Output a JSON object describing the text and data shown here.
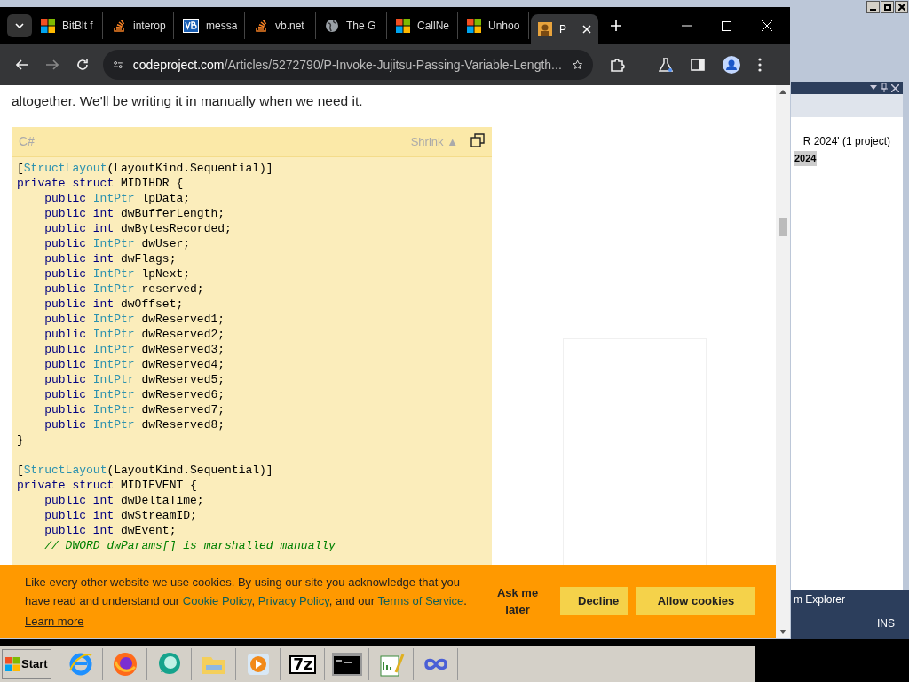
{
  "browser": {
    "tabs": [
      {
        "title": "BitBlt f",
        "kind": "windows",
        "selected": false
      },
      {
        "title": "interop",
        "kind": "stack",
        "selected": false
      },
      {
        "title": "messa",
        "kind": "vb",
        "selected": false
      },
      {
        "title": "vb.net",
        "kind": "stack",
        "selected": false
      },
      {
        "title": "The G",
        "kind": "globe",
        "selected": false
      },
      {
        "title": "CallNe",
        "kind": "windows",
        "selected": false
      },
      {
        "title": "Unhoo",
        "kind": "windows",
        "selected": false
      },
      {
        "title": "P",
        "kind": "site",
        "selected": true
      }
    ],
    "address": {
      "host": "codeproject.com",
      "path": "/Articles/5272790/P-Invoke-Jujitsu-Passing-Variable-Length..."
    }
  },
  "article": {
    "paragraph": "altogether. We'll be writing it in manually when we need it.",
    "code_block": {
      "language": "C#",
      "toggle": "Shrink ▲",
      "sections": [
        [
          [
            {
              "kind": "plain",
              "text": "["
            },
            {
              "kind": "type",
              "text": "StructLayout"
            },
            {
              "kind": "plain",
              "text": "(LayoutKind.Sequential)]"
            }
          ],
          [
            {
              "kind": "keyword",
              "text": "private struct"
            },
            {
              "kind": "plain",
              "text": " MIDIHDR {"
            }
          ],
          [
            {
              "kind": "keyword",
              "text": "    public"
            },
            {
              "kind": "type",
              "text": " IntPtr"
            },
            {
              "kind": "plain",
              "text": " lpData;"
            }
          ],
          [
            {
              "kind": "keyword",
              "text": "    public int"
            },
            {
              "kind": "plain",
              "text": " dwBufferLength;"
            }
          ],
          [
            {
              "kind": "keyword",
              "text": "    public int"
            },
            {
              "kind": "plain",
              "text": " dwBytesRecorded;"
            }
          ],
          [
            {
              "kind": "keyword",
              "text": "    public"
            },
            {
              "kind": "type",
              "text": " IntPtr"
            },
            {
              "kind": "plain",
              "text": " dwUser;"
            }
          ],
          [
            {
              "kind": "keyword",
              "text": "    public int"
            },
            {
              "kind": "plain",
              "text": " dwFlags;"
            }
          ],
          [
            {
              "kind": "keyword",
              "text": "    public"
            },
            {
              "kind": "type",
              "text": " IntPtr"
            },
            {
              "kind": "plain",
              "text": " lpNext;"
            }
          ],
          [
            {
              "kind": "keyword",
              "text": "    public"
            },
            {
              "kind": "type",
              "text": " IntPtr"
            },
            {
              "kind": "plain",
              "text": " reserved;"
            }
          ],
          [
            {
              "kind": "keyword",
              "text": "    public int"
            },
            {
              "kind": "plain",
              "text": " dwOffset;"
            }
          ],
          [
            {
              "kind": "keyword",
              "text": "    public"
            },
            {
              "kind": "type",
              "text": " IntPtr"
            },
            {
              "kind": "plain",
              "text": " dwReserved1;"
            }
          ],
          [
            {
              "kind": "keyword",
              "text": "    public"
            },
            {
              "kind": "type",
              "text": " IntPtr"
            },
            {
              "kind": "plain",
              "text": " dwReserved2;"
            }
          ],
          [
            {
              "kind": "keyword",
              "text": "    public"
            },
            {
              "kind": "type",
              "text": " IntPtr"
            },
            {
              "kind": "plain",
              "text": " dwReserved3;"
            }
          ],
          [
            {
              "kind": "keyword",
              "text": "    public"
            },
            {
              "kind": "type",
              "text": " IntPtr"
            },
            {
              "kind": "plain",
              "text": " dwReserved4;"
            }
          ],
          [
            {
              "kind": "keyword",
              "text": "    public"
            },
            {
              "kind": "type",
              "text": " IntPtr"
            },
            {
              "kind": "plain",
              "text": " dwReserved5;"
            }
          ],
          [
            {
              "kind": "keyword",
              "text": "    public"
            },
            {
              "kind": "type",
              "text": " IntPtr"
            },
            {
              "kind": "plain",
              "text": " dwReserved6;"
            }
          ],
          [
            {
              "kind": "keyword",
              "text": "    public"
            },
            {
              "kind": "type",
              "text": " IntPtr"
            },
            {
              "kind": "plain",
              "text": " dwReserved7;"
            }
          ],
          [
            {
              "kind": "keyword",
              "text": "    public"
            },
            {
              "kind": "type",
              "text": " IntPtr"
            },
            {
              "kind": "plain",
              "text": " dwReserved8;"
            }
          ],
          [
            {
              "kind": "plain",
              "text": "}"
            }
          ]
        ],
        [
          [
            {
              "kind": "plain",
              "text": "["
            },
            {
              "kind": "type",
              "text": "StructLayout"
            },
            {
              "kind": "plain",
              "text": "(LayoutKind.Sequential)]"
            }
          ],
          [
            {
              "kind": "keyword",
              "text": "private struct"
            },
            {
              "kind": "plain",
              "text": " MIDIEVENT {"
            }
          ],
          [
            {
              "kind": "keyword",
              "text": "    public int"
            },
            {
              "kind": "plain",
              "text": " dwDeltaTime;"
            }
          ],
          [
            {
              "kind": "keyword",
              "text": "    public int"
            },
            {
              "kind": "plain",
              "text": " dwStreamID;"
            }
          ],
          [
            {
              "kind": "keyword",
              "text": "    public int"
            },
            {
              "kind": "plain",
              "text": " dwEvent;"
            }
          ],
          [
            {
              "kind": "comment",
              "text": "    // DWORD dwParams[] is marshalled manually"
            }
          ]
        ]
      ]
    }
  },
  "cookie_banner": {
    "message": [
      {
        "kind": "text",
        "text": "Like every other website we use cookies. By using our site you acknowledge that you have read and understand our "
      },
      {
        "kind": "link",
        "text": "Cookie Policy"
      },
      {
        "kind": "text",
        "text": ", "
      },
      {
        "kind": "link",
        "text": "Privacy Policy"
      },
      {
        "kind": "text",
        "text": ", and our "
      },
      {
        "kind": "link",
        "text": "Terms of Service"
      },
      {
        "kind": "text",
        "text": "."
      }
    ],
    "learn_more": "Learn more",
    "buttons": [
      {
        "label": "Ask me later",
        "kind": "plain"
      },
      {
        "label": "Decline",
        "kind": "filled"
      },
      {
        "label": "Allow cookies",
        "kind": "filled"
      }
    ]
  },
  "ide": {
    "solution_line": "R 2024' (1 project)",
    "project_line": "2024",
    "tab_label": "m Explorer",
    "status": "INS"
  },
  "taskbar": {
    "start": "Start",
    "apps": [
      {
        "kind": "ie"
      },
      {
        "kind": "firefox"
      },
      {
        "kind": "chat"
      },
      {
        "kind": "folder"
      },
      {
        "kind": "media"
      },
      {
        "kind": "archiver",
        "label": "7z"
      },
      {
        "kind": "cmd"
      },
      {
        "kind": "notepad"
      },
      {
        "kind": "vs"
      }
    ]
  }
}
